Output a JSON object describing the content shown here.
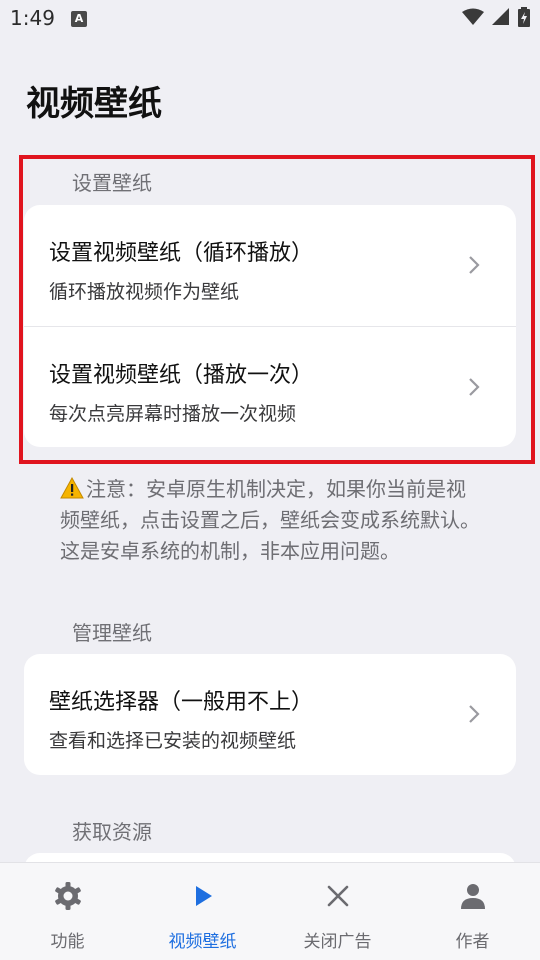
{
  "status_bar": {
    "time": "1:49",
    "notification_badge": "A"
  },
  "page": {
    "title": "视频壁纸"
  },
  "sections": {
    "set": {
      "label": "设置壁纸",
      "items": [
        {
          "title": "设置视频壁纸（循环播放）",
          "subtitle": "循环播放视频作为壁纸"
        },
        {
          "title": "设置视频壁纸（播放一次）",
          "subtitle": "每次点亮屏幕时播放一次视频"
        }
      ]
    },
    "note": {
      "icon": "warning-icon",
      "text": "注意：安卓原生机制决定，如果你当前是视频壁纸，点击设置之后，壁纸会变成系统默认。这是安卓系统的机制，非本应用问题。"
    },
    "manage": {
      "label": "管理壁纸",
      "items": [
        {
          "title": "壁纸选择器（一般用不上）",
          "subtitle": "查看和选择已安装的视频壁纸"
        }
      ]
    },
    "resources": {
      "label": "获取资源"
    }
  },
  "bottom_nav": {
    "items": [
      {
        "label": "功能",
        "icon": "gear-icon"
      },
      {
        "label": "视频壁纸",
        "icon": "play-icon",
        "active": true
      },
      {
        "label": "关闭广告",
        "icon": "close-icon"
      },
      {
        "label": "作者",
        "icon": "person-icon"
      }
    ]
  },
  "colors": {
    "background": "#efeff4",
    "card": "#ffffff",
    "accent": "#1e6fe0",
    "highlight_border": "#e0141e",
    "warning": "#f5b400"
  }
}
